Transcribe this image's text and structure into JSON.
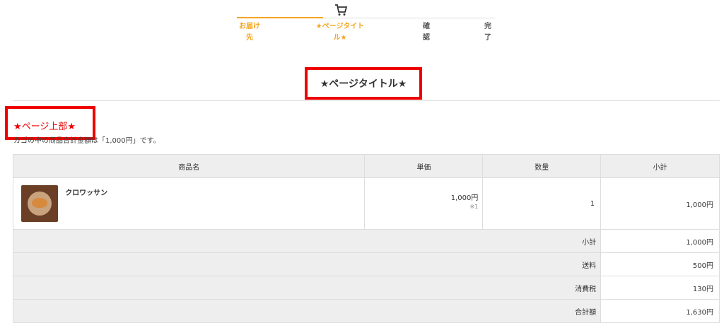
{
  "steps": [
    {
      "line1": "お届け",
      "line2": "先"
    },
    {
      "line1": "★ページタイト",
      "line2": "ル★"
    },
    {
      "line1": "確",
      "line2": "認"
    },
    {
      "line1": "完",
      "line2": "了"
    }
  ],
  "header": {
    "cart_icon": "cart-icon",
    "accent_color": "#f5a623",
    "current_step": 2,
    "total_steps": 4
  },
  "page_title": "★ページタイトル★",
  "page_top_label": "★ページ上部★",
  "note_text": "カゴの中の商品合計金額は「1,000円」です。",
  "table": {
    "headers": [
      "商品名",
      "単価",
      "数量",
      "小計"
    ],
    "items": [
      {
        "name": "クロワッサン",
        "price": "1,000円",
        "price_note": "※1",
        "qty": "1",
        "subtotal": "1,000円"
      }
    ],
    "summary": [
      {
        "label": "小計",
        "value": "1,000円"
      },
      {
        "label": "送料",
        "value": "500円"
      },
      {
        "label": "消費税",
        "value": "130円"
      },
      {
        "label": "合計額",
        "value": "1,630円"
      }
    ]
  }
}
